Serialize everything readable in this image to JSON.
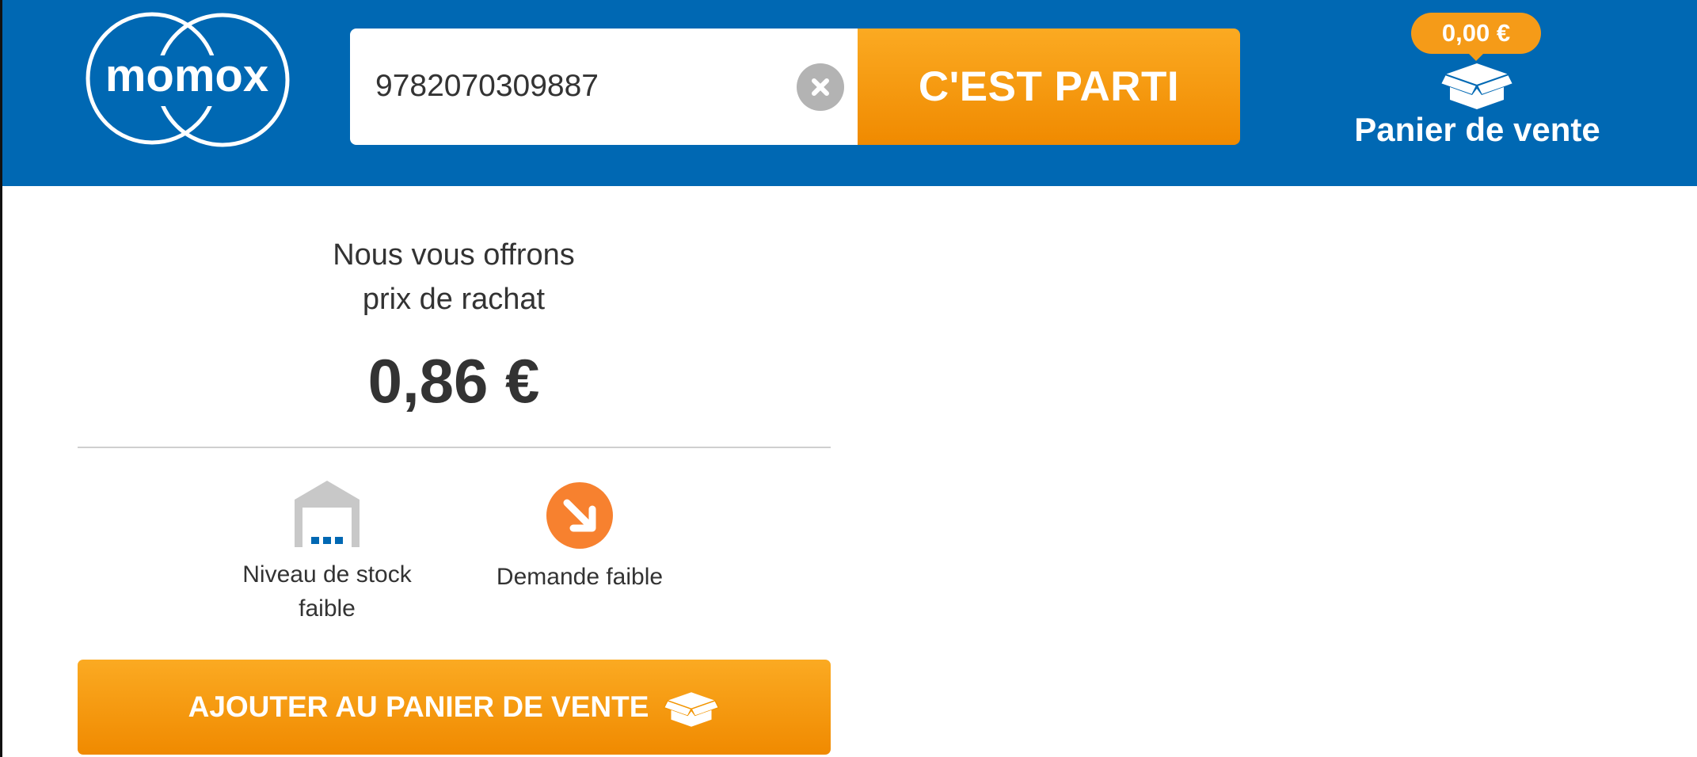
{
  "header": {
    "logo_text": "momox",
    "search": {
      "value": "9782070309887",
      "placeholder": ""
    },
    "search_button_label": "C'EST PARTI",
    "cart": {
      "price": "0,00 €",
      "label": "Panier de vente"
    }
  },
  "offer": {
    "intro_line1": "Nous vous offrons",
    "intro_line2": "prix de rachat",
    "price": "0,86 €",
    "stock_label_line1": "Niveau de stock",
    "stock_label_line2": "faible",
    "demand_label": "Demande faible",
    "add_button_label": "AJOUTER AU PANIER DE VENTE"
  },
  "colors": {
    "header_bg": "#0068b3",
    "accent_orange": "#f59b18",
    "demand_icon": "#f7812f",
    "warehouse_gray": "#c8c8c8",
    "text": "#333333"
  },
  "icons": {
    "clear": "close-icon",
    "cart": "box-icon",
    "stock": "warehouse-icon",
    "demand": "arrow-down-right-icon"
  }
}
